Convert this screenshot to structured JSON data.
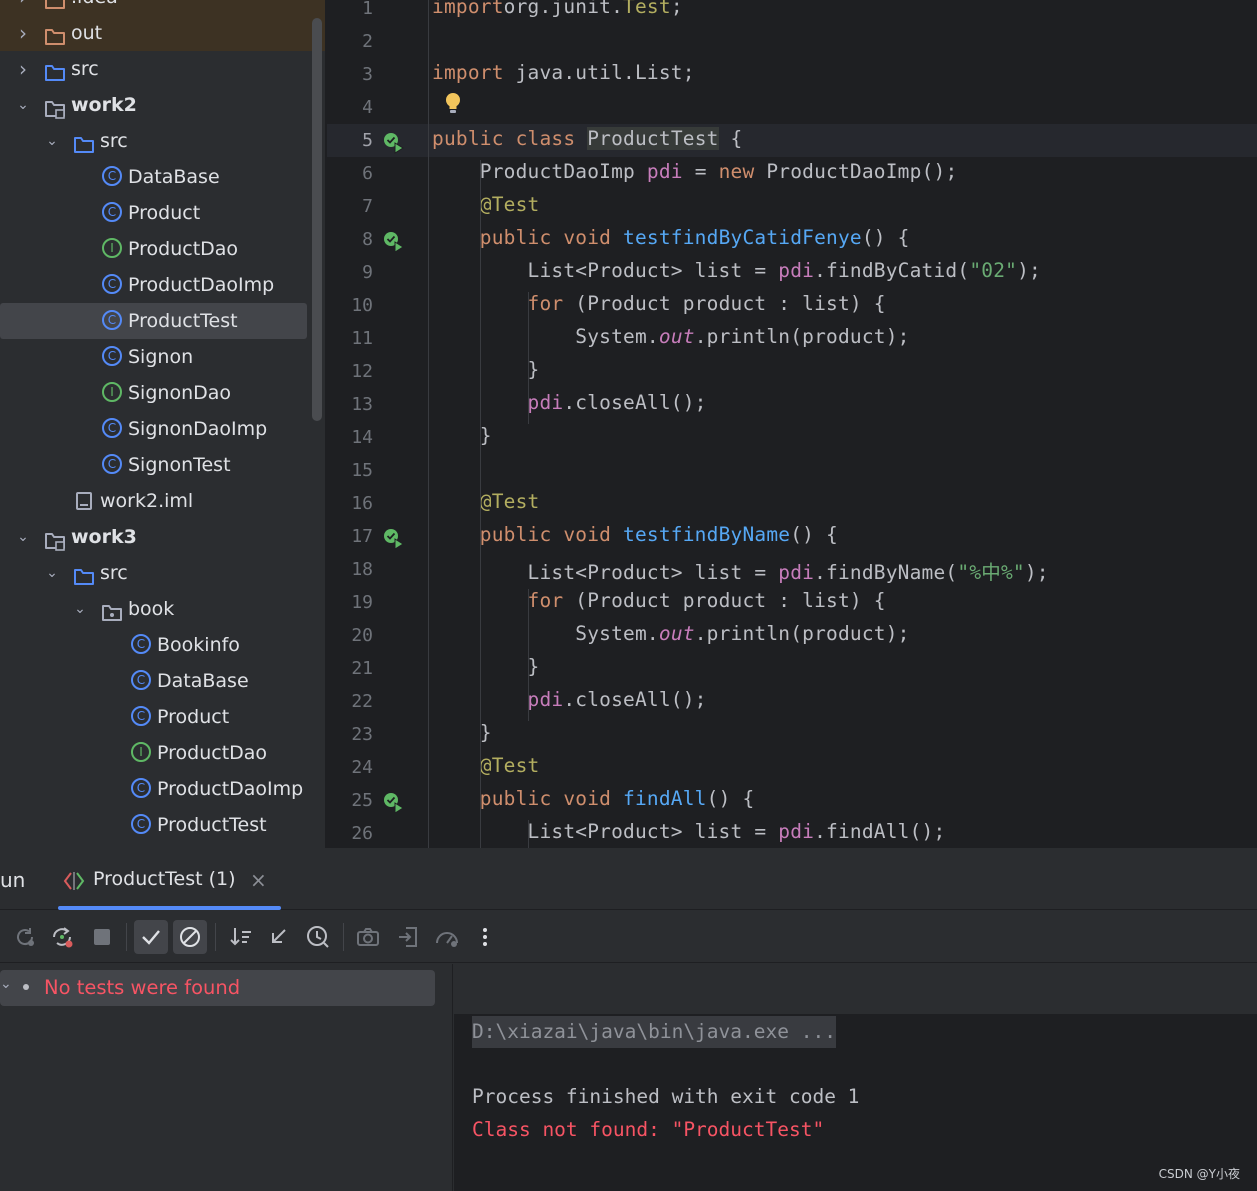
{
  "project_tree": {
    "items": [
      {
        "label": ".idea",
        "kind": "folder",
        "depth": 0,
        "expanded": false
      },
      {
        "label": "out",
        "kind": "folder",
        "depth": 0,
        "expanded": false
      },
      {
        "label": "src",
        "kind": "source-folder",
        "depth": 0,
        "expanded": false
      },
      {
        "label": "work2",
        "kind": "module",
        "depth": 0,
        "expanded": true
      },
      {
        "label": "src",
        "kind": "source-folder",
        "depth": 1,
        "expanded": true
      },
      {
        "label": "DataBase",
        "kind": "class",
        "depth": 2
      },
      {
        "label": "Product",
        "kind": "class",
        "depth": 2
      },
      {
        "label": "ProductDao",
        "kind": "interface",
        "depth": 2
      },
      {
        "label": "ProductDaoImp",
        "kind": "class",
        "depth": 2
      },
      {
        "label": "ProductTest",
        "kind": "class",
        "depth": 2,
        "selected": true
      },
      {
        "label": "Signon",
        "kind": "class",
        "depth": 2
      },
      {
        "label": "SignonDao",
        "kind": "interface",
        "depth": 2
      },
      {
        "label": "SignonDaoImp",
        "kind": "class",
        "depth": 2
      },
      {
        "label": "SignonTest",
        "kind": "class",
        "depth": 2
      },
      {
        "label": "work2.iml",
        "kind": "file",
        "depth": 1
      },
      {
        "label": "work3",
        "kind": "module",
        "depth": 0,
        "expanded": true
      },
      {
        "label": "src",
        "kind": "source-folder",
        "depth": 1,
        "expanded": true
      },
      {
        "label": "book",
        "kind": "package",
        "depth": 2,
        "expanded": true
      },
      {
        "label": "Bookinfo",
        "kind": "class",
        "depth": 3
      },
      {
        "label": "DataBase",
        "kind": "class",
        "depth": 3
      },
      {
        "label": "Product",
        "kind": "class",
        "depth": 3
      },
      {
        "label": "ProductDao",
        "kind": "interface",
        "depth": 3
      },
      {
        "label": "ProductDaoImp",
        "kind": "class",
        "depth": 3
      },
      {
        "label": "ProductTest",
        "kind": "class",
        "depth": 3
      }
    ]
  },
  "editor": {
    "lines": [
      {
        "n": "1",
        "tokens": [
          [
            "kw",
            "import"
          ],
          [
            "",
            "org.junit."
          ],
          [
            "ann",
            "Test"
          ],
          [
            "",
            ";"
          ]
        ]
      },
      {
        "n": "2",
        "tokens": []
      },
      {
        "n": "3",
        "tokens": [
          [
            "kw",
            "import"
          ],
          [
            "",
            " java.util.List;"
          ]
        ]
      },
      {
        "n": "4",
        "tokens": []
      },
      {
        "n": "5",
        "tokens": [
          [
            "kw",
            "public class "
          ],
          [
            "clshl",
            "ProductTest"
          ],
          [
            "",
            " {"
          ]
        ],
        "run": true,
        "active": true
      },
      {
        "n": "6",
        "tokens": [
          [
            "",
            "    ProductDaoImp "
          ],
          [
            "fld",
            "pdi"
          ],
          [
            "",
            " = "
          ],
          [
            "kw",
            "new"
          ],
          [
            "",
            " ProductDaoImp();"
          ]
        ]
      },
      {
        "n": "7",
        "tokens": [
          [
            "ann",
            "    @Test"
          ]
        ]
      },
      {
        "n": "8",
        "tokens": [
          [
            "kw",
            "    public void "
          ],
          [
            "fn",
            "testfindByCatidFenye"
          ],
          [
            "",
            "() {"
          ]
        ],
        "run": true
      },
      {
        "n": "9",
        "tokens": [
          [
            "",
            "        List<Product> list = "
          ],
          [
            "fld",
            "pdi"
          ],
          [
            "",
            ".findByCatid("
          ],
          [
            "str",
            "\"02\""
          ],
          [
            "",
            ");"
          ]
        ]
      },
      {
        "n": "10",
        "tokens": [
          [
            "kw",
            "        for"
          ],
          [
            "",
            " (Product product : list) {"
          ]
        ]
      },
      {
        "n": "11",
        "tokens": [
          [
            "",
            "            System."
          ],
          [
            "fldit",
            "out"
          ],
          [
            "",
            ".println(product);"
          ]
        ]
      },
      {
        "n": "12",
        "tokens": [
          [
            "",
            "        }"
          ]
        ]
      },
      {
        "n": "13",
        "tokens": [
          [
            "fld",
            "        pdi"
          ],
          [
            "",
            ".closeAll();"
          ]
        ]
      },
      {
        "n": "14",
        "tokens": [
          [
            "",
            "    }"
          ]
        ]
      },
      {
        "n": "15",
        "tokens": []
      },
      {
        "n": "16",
        "tokens": [
          [
            "ann",
            "    @Test"
          ]
        ]
      },
      {
        "n": "17",
        "tokens": [
          [
            "kw",
            "    public void "
          ],
          [
            "fn",
            "testfindByName"
          ],
          [
            "",
            "() {"
          ]
        ],
        "run": true
      },
      {
        "n": "18",
        "tokens": [
          [
            "",
            "        List<Product> list = "
          ],
          [
            "fld",
            "pdi"
          ],
          [
            "",
            ".findByName("
          ],
          [
            "str",
            "\"%中%\""
          ],
          [
            "",
            ");"
          ]
        ]
      },
      {
        "n": "19",
        "tokens": [
          [
            "kw",
            "        for"
          ],
          [
            "",
            " (Product product : list) {"
          ]
        ]
      },
      {
        "n": "20",
        "tokens": [
          [
            "",
            "            System."
          ],
          [
            "fldit",
            "out"
          ],
          [
            "",
            ".println(product);"
          ]
        ]
      },
      {
        "n": "21",
        "tokens": [
          [
            "",
            "        }"
          ]
        ]
      },
      {
        "n": "22",
        "tokens": [
          [
            "fld",
            "        pdi"
          ],
          [
            "",
            ".closeAll();"
          ]
        ]
      },
      {
        "n": "23",
        "tokens": [
          [
            "",
            "    }"
          ]
        ]
      },
      {
        "n": "24",
        "tokens": [
          [
            "ann",
            "    @Test"
          ]
        ]
      },
      {
        "n": "25",
        "tokens": [
          [
            "kw",
            "    public void "
          ],
          [
            "fn",
            "findAll"
          ],
          [
            "",
            "() {"
          ]
        ],
        "run": true
      },
      {
        "n": "26",
        "tokens": [
          [
            "",
            "        List<Product> list = "
          ],
          [
            "fld",
            "pdi"
          ],
          [
            "",
            ".findAll();"
          ]
        ]
      }
    ]
  },
  "run_window": {
    "title": "un",
    "tab_label": "ProductTest (1)",
    "toolbar": [
      "rerun-icon",
      "rerun-failed-icon",
      "stop-icon",
      "show-passed-icon",
      "show-ignored-icon",
      "sort-icon",
      "collapse-icon",
      "history-icon",
      "screenshot-icon",
      "import-icon",
      "coverage-icon",
      "more-icon"
    ],
    "test_status": "No tests were found",
    "console": {
      "command": "D:\\xiazai\\java\\bin\\java.exe ...",
      "process": "Process finished with exit code 1",
      "error": "Class not found: \"ProductTest\""
    }
  },
  "watermark": "CSDN @Y小夜",
  "colors": {
    "keyword": "#cf8e6d",
    "function": "#56a8f5",
    "field": "#c77dbb",
    "string": "#6aab73",
    "annotation": "#b3ae60",
    "error": "#f75464",
    "accent": "#548af7"
  }
}
